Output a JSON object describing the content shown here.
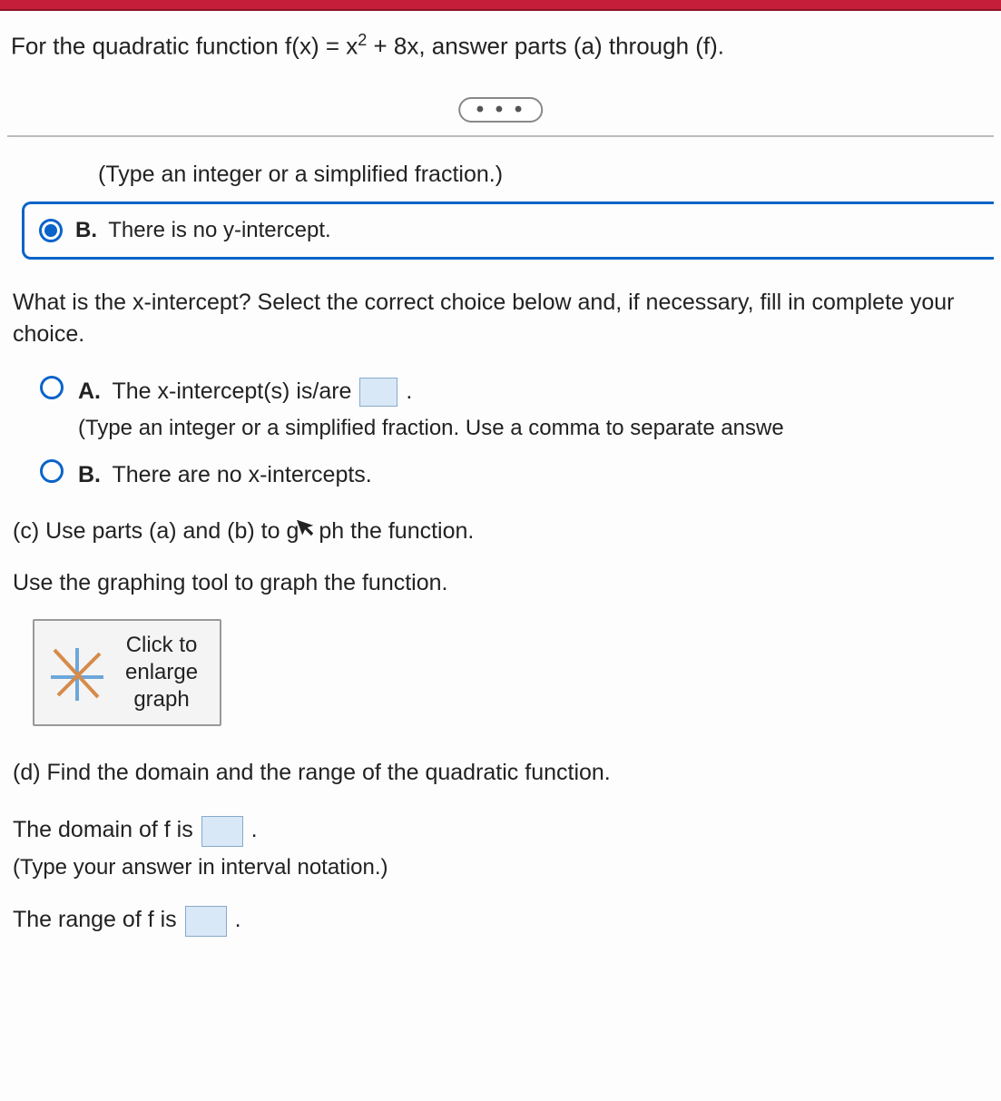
{
  "stem_prefix": "For the quadratic function f(x) = x",
  "stem_exp": "2",
  "stem_suffix": " + 8x, answer parts (a) through (f).",
  "ellipsis": "• • •",
  "hint_top": "(Type an integer or a simplified fraction.)",
  "optB_selected": {
    "label": "B.",
    "text": "There is no y-intercept."
  },
  "xint_question": "What is the x-intercept? Select the correct choice below and, if necessary, fill in complete your choice.",
  "xint_A": {
    "label": "A.",
    "text_before": "The x-intercept(s) is/are ",
    "text_after": ".",
    "hint": "(Type an integer or a simplified fraction. Use a comma to separate answe"
  },
  "xint_B": {
    "label": "B.",
    "text": "There are no x-intercepts."
  },
  "part_c_before": "(c) Use parts (a) and (b) to g",
  "part_c_after": "ph the function.",
  "graph_instr": "Use the graphing tool to graph the function.",
  "graph_btn_l1": "Click to",
  "graph_btn_l2": "enlarge",
  "graph_btn_l3": "graph",
  "part_d": "(d) Find the domain and the range of the quadratic function.",
  "domain_before": "The domain of f is ",
  "domain_after": ".",
  "interval_hint": "(Type your answer in interval notation.)",
  "range_before": "The range of f is ",
  "range_after": "."
}
